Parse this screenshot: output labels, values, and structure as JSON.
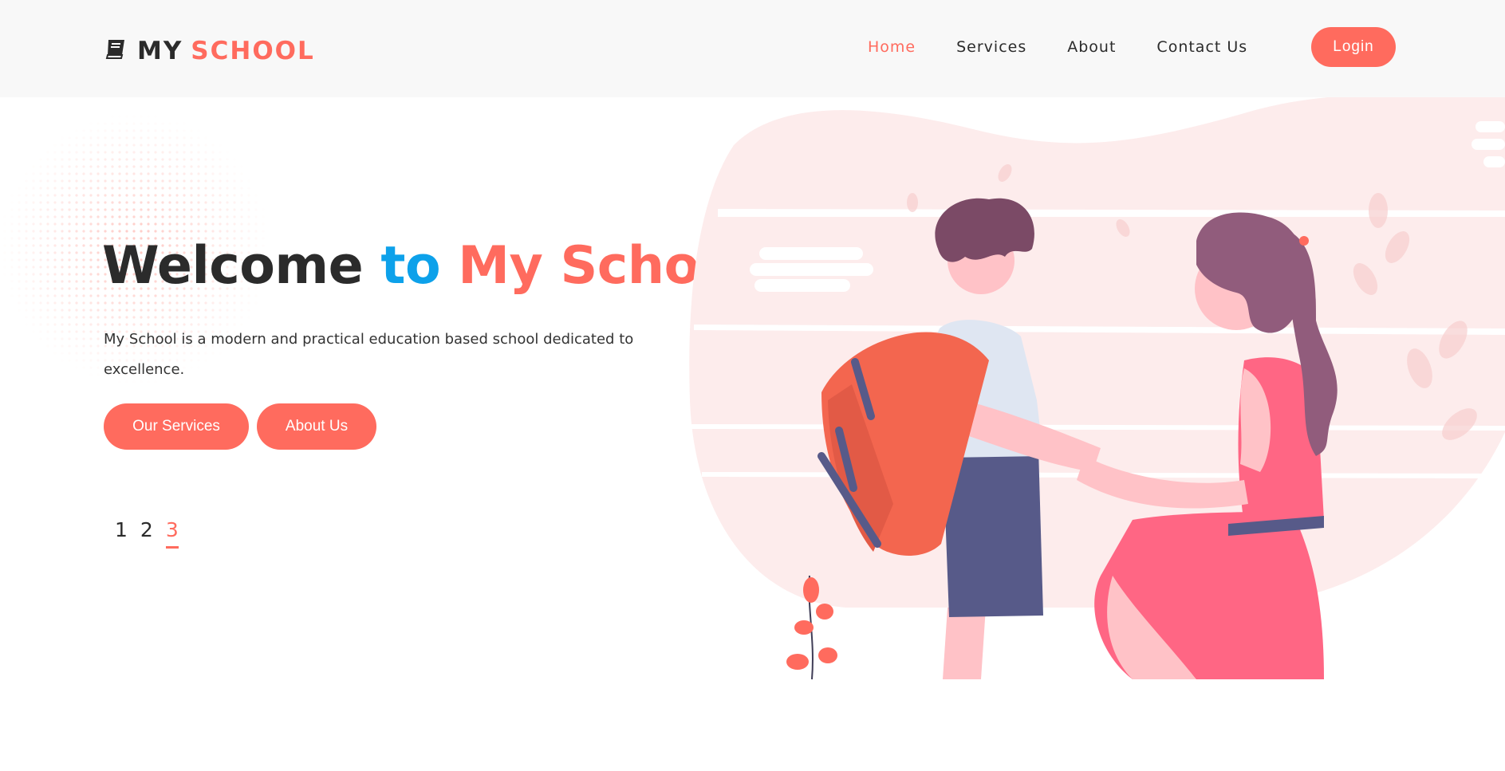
{
  "header": {
    "logo": {
      "icon": "book-icon",
      "part1": "MY",
      "part2": "SCHOOL"
    },
    "nav": [
      {
        "label": "Home",
        "active": true
      },
      {
        "label": "Services",
        "active": false
      },
      {
        "label": "About",
        "active": false
      },
      {
        "label": "Contact Us",
        "active": false
      }
    ],
    "login_label": "Login"
  },
  "hero": {
    "title": {
      "welcome": "Welcome",
      "to": "to",
      "myschool": "My School"
    },
    "description": "My School is a modern and practical education based school dedicated to excellence.",
    "buttons": {
      "services": "Our Services",
      "about": "About Us"
    },
    "slider_pages": [
      "1",
      "2",
      "3"
    ],
    "active_page": "3"
  },
  "colors": {
    "accent": "#ff6b5e",
    "blue": "#0da1ea",
    "dark": "#2b2b2b",
    "header_bg": "#f8f8f8",
    "blob": "#fdecec"
  }
}
